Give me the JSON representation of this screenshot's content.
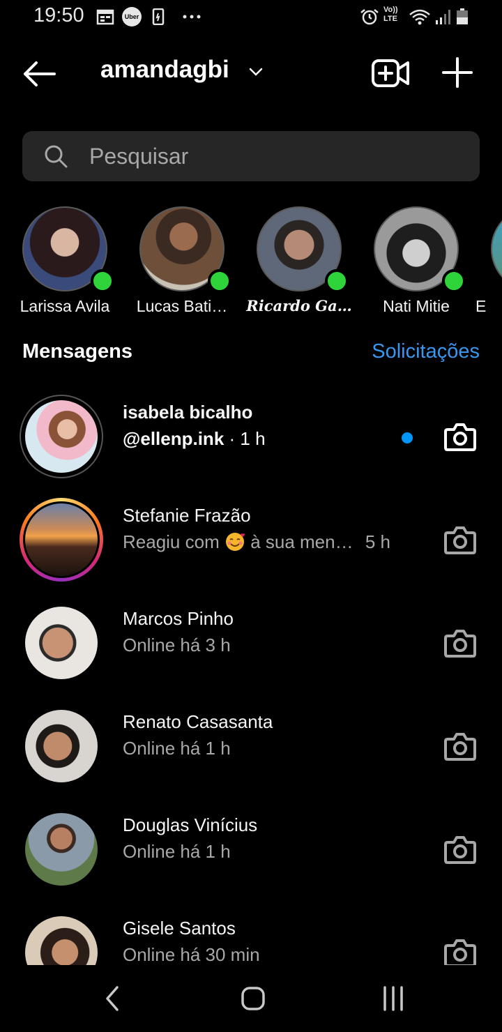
{
  "status_bar": {
    "time": "19:50",
    "left_icons": [
      "calendar-icon",
      "uber-icon",
      "phone-notification-icon",
      "more-dots-icon"
    ],
    "right_icons": [
      "alarm-icon",
      "volte-icon",
      "wifi-icon",
      "signal-icon",
      "battery-icon"
    ],
    "volte_text": "Vo)) LTE",
    "uber_text": "Uber"
  },
  "header": {
    "account_name": "amandagbi",
    "icons": [
      "back-arrow-icon",
      "chevron-down-icon",
      "video-call-icon",
      "plus-icon"
    ]
  },
  "search": {
    "placeholder": "Pesquisar"
  },
  "stories": [
    {
      "name": "Larissa Avila",
      "online": true
    },
    {
      "name": "Lucas Bati…",
      "online": true
    },
    {
      "name": "Ricardo Ga…",
      "online": true
    },
    {
      "name": "Nati Mitie",
      "online": true
    },
    {
      "name": "E",
      "online": false
    }
  ],
  "section": {
    "title": "Mensagens",
    "requests": "Solicitações"
  },
  "messages": [
    {
      "name": "isabela bicalho",
      "subtitle": "@ellenp.ink",
      "time": " · 1 h",
      "unread": true
    },
    {
      "name": "Stefanie Frazão",
      "subtitle_prefix": "Reagiu com ",
      "subtitle_suffix": " à sua men…",
      "time": "5 h",
      "emoji": "smiling-face-with-hearts",
      "unread": false
    },
    {
      "name": "Marcos Pinho",
      "subtitle": "Online há 3 h",
      "unread": false
    },
    {
      "name": "Renato Casasanta",
      "subtitle": "Online há 1 h",
      "unread": false
    },
    {
      "name": "Douglas Vinícius",
      "subtitle": "Online há 1 h",
      "unread": false
    },
    {
      "name": "Gisele Santos",
      "subtitle": "Online há 30 min",
      "unread": false
    }
  ],
  "nav": {
    "icons": [
      "nav-back-icon",
      "nav-home-icon",
      "nav-recents-icon"
    ]
  },
  "colors": {
    "background": "#000000",
    "search_bg": "#262626",
    "online": "#2fd33a",
    "link": "#3897f0",
    "unread_dot": "#0095f6",
    "secondary_text": "#a8a8a8"
  }
}
